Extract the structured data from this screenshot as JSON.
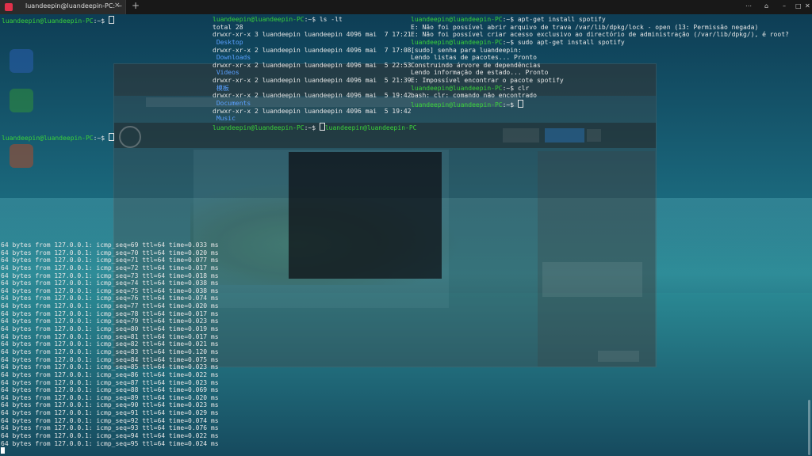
{
  "window": {
    "tab_title": "luandeepin@luandeepin-PC: ~",
    "tab_close": "×",
    "new_tab": "+",
    "buttons": [
      "⋯",
      "⌂",
      "–",
      "□",
      "✕"
    ]
  },
  "pane1": {
    "lines": [
      {
        "prompt": "luandeepin@luandeepin-PC",
        "suffix": ":~$ ",
        "text": "",
        "cursor": true
      }
    ]
  },
  "pane2": {
    "lines": [
      {
        "prompt": "luandeepin@luandeepin-PC",
        "suffix": ":~$ ",
        "text": "ls -lt"
      },
      {
        "text": "total 28"
      },
      {
        "text": "drwxr-xr-x 3 luandeepin luandeepin 4096 mai  7 17:21"
      },
      {
        "text": " Desktop",
        "dir": true
      },
      {
        "text": "drwxr-xr-x 2 luandeepin luandeepin 4096 mai  7 17:08"
      },
      {
        "text": " Downloads",
        "dir": true
      },
      {
        "text": "drwxr-xr-x 2 luandeepin luandeepin 4096 mai  5 22:53"
      },
      {
        "text": " Videos",
        "dir": true
      },
      {
        "text": "drwxr-xr-x 2 luandeepin luandeepin 4096 mai  5 21:39"
      },
      {
        "text": " 模板",
        "dir": true
      },
      {
        "text": "drwxr-xr-x 2 luandeepin luandeepin 4096 mai  5 19:42"
      },
      {
        "text": " Documents",
        "dir": true
      },
      {
        "text": "drwxr-xr-x 2 luandeepin luandeepin 4096 mai  5 19:42"
      },
      {
        "text": " Music",
        "dir": true
      },
      {
        "prompt": "luandeepin@luandeepin-PC",
        "suffix": ":~$ ",
        "text": "",
        "tail": "luandeepin@luandeepin-PC",
        "cursor_inline": true
      }
    ]
  },
  "pane3": {
    "lines": [
      {
        "prompt": "luandeepin@luandeepin-PC",
        "suffix": ":~$ ",
        "text": "apt-get install spotify"
      },
      {
        "text": "E: Não foi possível abrir arquivo de trava /var/lib/dpkg/lock - open (13: Permissão negada)"
      },
      {
        "text": "E: Não foi possível criar acesso exclusivo ao directório de administração (/var/lib/dpkg/), é root?"
      },
      {
        "prompt": "luandeepin@luandeepin-PC",
        "suffix": ":~$ ",
        "text": "sudo apt-get install spotify"
      },
      {
        "text": "[sudo] senha para luandeepin:"
      },
      {
        "text": "Lendo listas de pacotes... Pronto"
      },
      {
        "text": "Construindo árvore de dependências"
      },
      {
        "text": "Lendo informação de estado... Pronto"
      },
      {
        "text": "E: Impossível encontrar o pacote spotify"
      },
      {
        "prompt": "luandeepin@luandeepin-PC",
        "suffix": ":~$ ",
        "text": "clr"
      },
      {
        "text": "bash: clr: comando não encontrado"
      },
      {
        "prompt": "luandeepin@luandeepin-PC",
        "suffix": ":~$ ",
        "text": "",
        "cursor": true
      }
    ]
  },
  "pane4": {
    "lines": [
      {
        "prompt": "luandeepin@luandeepin-PC",
        "suffix": ":~$ ",
        "text": "",
        "cursor": true
      }
    ]
  },
  "ping": {
    "prefix": "64 bytes from 127.0.0.1: icmp_seq=",
    "rows": [
      [
        "69",
        "0.033"
      ],
      [
        "70",
        "0.020"
      ],
      [
        "71",
        "0.077"
      ],
      [
        "72",
        "0.017"
      ],
      [
        "73",
        "0.018"
      ],
      [
        "74",
        "0.038"
      ],
      [
        "75",
        "0.038"
      ],
      [
        "76",
        "0.074"
      ],
      [
        "77",
        "0.020"
      ],
      [
        "78",
        "0.017"
      ],
      [
        "79",
        "0.023"
      ],
      [
        "80",
        "0.019"
      ],
      [
        "81",
        "0.017"
      ],
      [
        "82",
        "0.021"
      ],
      [
        "83",
        "0.120"
      ],
      [
        "84",
        "0.075"
      ],
      [
        "85",
        "0.023"
      ],
      [
        "86",
        "0.022"
      ],
      [
        "87",
        "0.023"
      ],
      [
        "88",
        "0.069"
      ],
      [
        "89",
        "0.020"
      ],
      [
        "90",
        "0.023"
      ],
      [
        "91",
        "0.029"
      ],
      [
        "92",
        "0.074"
      ],
      [
        "93",
        "0.076"
      ],
      [
        "94",
        "0.022"
      ],
      [
        "95",
        "0.024"
      ]
    ]
  },
  "colors": {
    "prompt": "#3ad23a",
    "directory": "#5aa0ff",
    "accent": "#e0314a"
  }
}
